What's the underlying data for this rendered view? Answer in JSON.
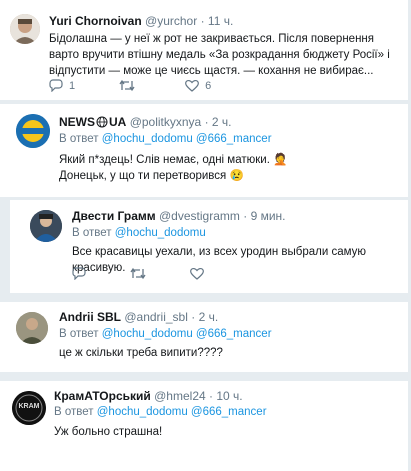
{
  "reply_to_prefix": "В ответ",
  "tweets": [
    {
      "name": "Yuri Chornoivan",
      "handle": "@yurchor",
      "dot": "·",
      "time": "11 ч.",
      "text": "Бідолашна — у неї ж рот не закривається. Після повернення варто вручити втішну медаль «За розкрадання бюджету Росії» і відпустити — може це чиєсь щастя. — кохання не вибирає...",
      "replies": "1",
      "likes": "6"
    },
    {
      "name": "NEWS",
      "name_suffix": "UA",
      "handle": "@politkyxnya",
      "dot": "·",
      "time": "2 ч.",
      "mentions": [
        "@hochu_dodomu",
        "@666_mancer"
      ],
      "line1": "Який п*здець! Слів немає, одні матюки. 🤦",
      "line2": "Донецьк, у що ти перетворився 😢"
    },
    {
      "name": "Двести Грамм",
      "handle": "@dvestigramm",
      "dot": "·",
      "time": "9 мин.",
      "mentions": [
        "@hochu_dodomu"
      ],
      "text": "Все красавицы уехали, из всех уродин выбрали самую красивую."
    },
    {
      "name": "Andrii SBL",
      "handle": "@andrii_sbl",
      "dot": "·",
      "time": "2 ч.",
      "mentions": [
        "@hochu_dodomu",
        "@666_mancer"
      ],
      "text": "це ж скільки треба випити????"
    },
    {
      "name": "КрамАТОрський",
      "handle": "@hmel24",
      "dot": "·",
      "time": "10 ч.",
      "mentions": [
        "@hochu_dodomu",
        "@666_mancer"
      ],
      "text": "Уж больно страшна!",
      "avatar_text": "KRAM"
    }
  ]
}
